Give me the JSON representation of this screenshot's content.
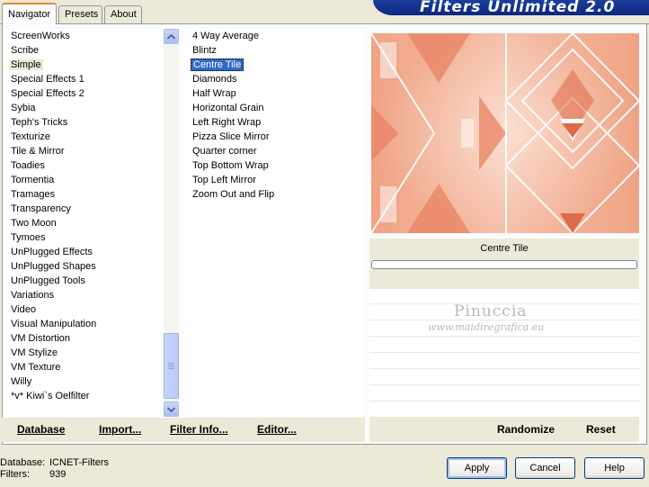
{
  "tabs": [
    {
      "label": "Navigator",
      "active": true
    },
    {
      "label": "Presets",
      "active": false
    },
    {
      "label": "About",
      "active": false
    }
  ],
  "banner": {
    "title": "Filters Unlimited 2.0"
  },
  "categories": {
    "items": [
      "ScreenWorks",
      "Scribe",
      "Simple",
      "Special Effects 1",
      "Special Effects 2",
      "Sybia",
      "Teph's Tricks",
      "Texturize",
      "Tile & Mirror",
      "Toadies",
      "Tormentia",
      "Tramages",
      "Transparency",
      "Two Moon",
      "Tymoes",
      "UnPlugged Effects",
      "UnPlugged Shapes",
      "UnPlugged Tools",
      "Variations",
      "Video",
      "Visual Manipulation",
      "VM Distortion",
      "VM Stylize",
      "VM Texture",
      "Willy",
      "*v* Kiwi`s Oelfilter"
    ],
    "selected": "Simple"
  },
  "filters": {
    "items": [
      "4 Way Average",
      "Blintz",
      "Centre Tile",
      "Diamonds",
      "Half Wrap",
      "Horizontal Grain",
      "Left Right Wrap",
      "Pizza Slice Mirror",
      "Quarter corner",
      "Top Bottom Wrap",
      "Top Left Mirror",
      "Zoom Out and Flip"
    ],
    "selected": "Centre Tile"
  },
  "left_buttons": {
    "database": "Database",
    "import": "Import...",
    "filter_info": "Filter Info...",
    "editor": "Editor..."
  },
  "preview": {
    "caption": "Centre Tile"
  },
  "right_buttons": {
    "randomize": "Randomize",
    "reset": "Reset"
  },
  "watermark": {
    "name": "Pinuccia",
    "site": "www.maidiregrafica.eu"
  },
  "status": {
    "database_label": "Database:",
    "database_value": "ICNET-Filters",
    "filters_label": "Filters:",
    "filters_value": "939"
  },
  "dialog_buttons": {
    "apply": "Apply",
    "cancel": "Cancel",
    "help": "Help"
  },
  "colors": {
    "selection": "#316ac5",
    "banner": "#0a2680",
    "tab_accent": "#e68b2c",
    "preview_base": "#f6c7b0"
  }
}
